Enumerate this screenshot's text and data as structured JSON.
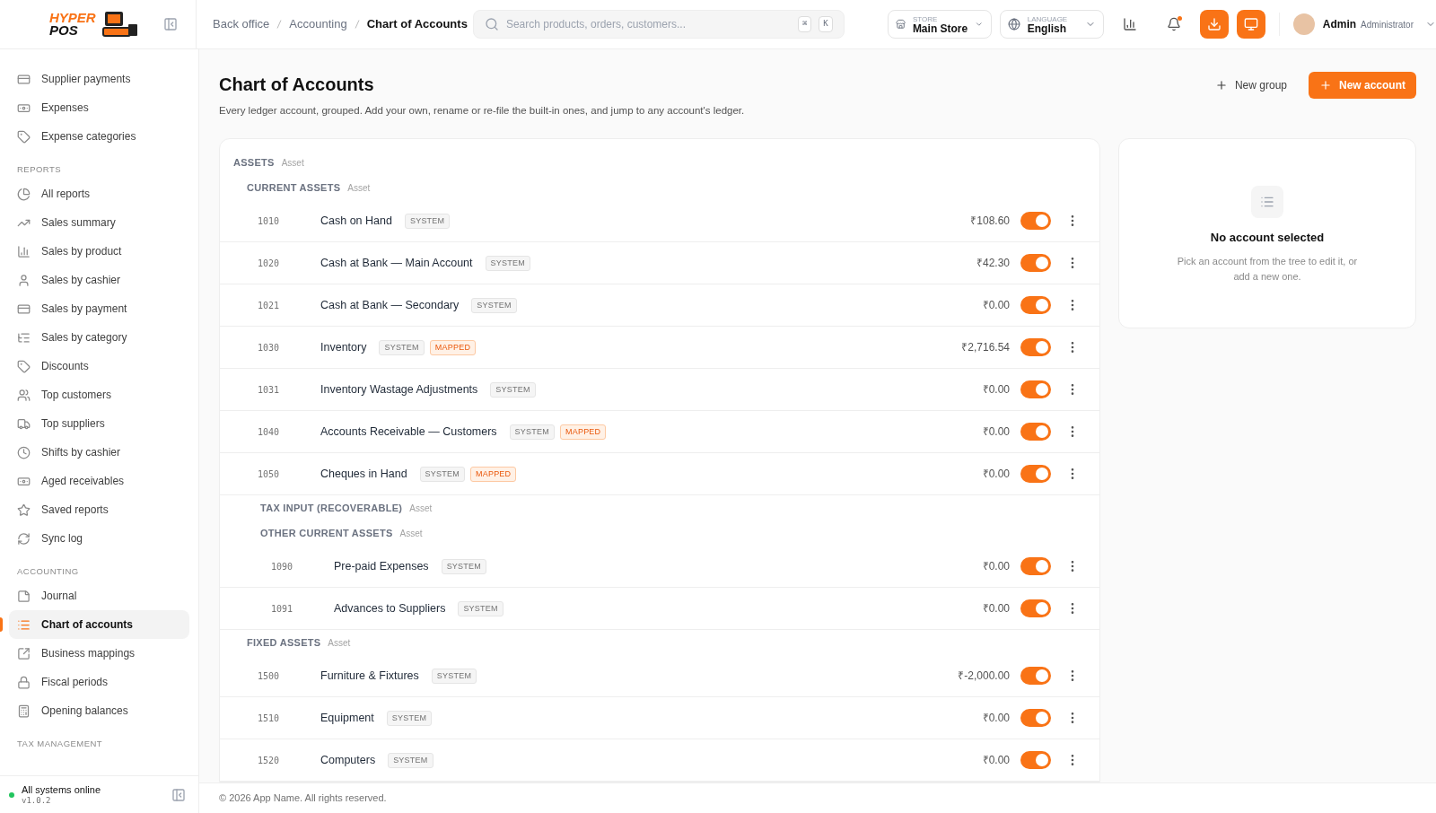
{
  "logo": {
    "line1": "HYPER",
    "line2": "POS"
  },
  "breadcrumb": [
    {
      "label": "Back office",
      "current": false
    },
    {
      "label": "Accounting",
      "current": false
    },
    {
      "label": "Chart of Accounts",
      "current": true
    }
  ],
  "search": {
    "placeholder": "Search products, orders, customers...",
    "keys": [
      "⌘",
      "K"
    ]
  },
  "store": {
    "caption": "STORE",
    "value": "Main Store"
  },
  "language": {
    "caption": "LANGUAGE",
    "value": "English"
  },
  "notifications": {
    "unread": true
  },
  "user": {
    "name": "Admin",
    "role": "Administrator"
  },
  "sidebar": {
    "sections": [
      {
        "items": [
          {
            "label": "Supplier payments",
            "selected": false
          },
          {
            "label": "Expenses",
            "selected": false
          },
          {
            "label": "Expense categories",
            "selected": false
          }
        ]
      },
      {
        "title": "REPORTS",
        "items": [
          {
            "label": "All reports",
            "selected": false
          },
          {
            "label": "Sales summary",
            "selected": false
          },
          {
            "label": "Sales by product",
            "selected": false
          },
          {
            "label": "Sales by cashier",
            "selected": false
          },
          {
            "label": "Sales by payment",
            "selected": false
          },
          {
            "label": "Sales by category",
            "selected": false
          },
          {
            "label": "Discounts",
            "selected": false
          },
          {
            "label": "Top customers",
            "selected": false
          },
          {
            "label": "Top suppliers",
            "selected": false
          },
          {
            "label": "Shifts by cashier",
            "selected": false
          },
          {
            "label": "Aged receivables",
            "selected": false
          },
          {
            "label": "Saved reports",
            "selected": false
          },
          {
            "label": "Sync log",
            "selected": false
          }
        ]
      },
      {
        "title": "ACCOUNTING",
        "items": [
          {
            "label": "Journal",
            "selected": false
          },
          {
            "label": "Chart of accounts",
            "selected": true
          },
          {
            "label": "Business mappings",
            "selected": false
          },
          {
            "label": "Fiscal periods",
            "selected": false
          },
          {
            "label": "Opening balances",
            "selected": false
          }
        ]
      },
      {
        "title": "TAX MANAGEMENT"
      }
    ],
    "status": {
      "label": "All systems online",
      "version": "v1.0.2"
    }
  },
  "page": {
    "title": "Chart of Accounts",
    "subtitle": "Every ledger account, grouped. Add your own, rename or re-file the built-in ones, and jump to any account's ledger.",
    "actions": [
      "New group",
      "New account"
    ]
  },
  "tree": [
    {
      "kind": "group",
      "label": "ASSETS",
      "type": "Asset",
      "children": [
        {
          "kind": "group",
          "label": "CURRENT ASSETS",
          "type": "Asset",
          "children": [
            {
              "kind": "account",
              "code": "1010",
              "name": "Cash on Hand",
              "tags": [
                {
                  "label": "SYSTEM",
                  "kind": "system"
                }
              ],
              "balance": "₹108.60",
              "on": true
            },
            {
              "kind": "account",
              "code": "1020",
              "name": "Cash at Bank — Main Account",
              "tags": [
                {
                  "label": "SYSTEM",
                  "kind": "system"
                }
              ],
              "balance": "₹42.30",
              "on": true
            },
            {
              "kind": "account",
              "code": "1021",
              "name": "Cash at Bank — Secondary",
              "tags": [
                {
                  "label": "SYSTEM",
                  "kind": "system"
                }
              ],
              "balance": "₹0.00",
              "on": true
            },
            {
              "kind": "account",
              "code": "1030",
              "name": "Inventory",
              "tags": [
                {
                  "label": "SYSTEM",
                  "kind": "system"
                },
                {
                  "label": "MAPPED",
                  "kind": "mapped"
                }
              ],
              "balance": "₹2,716.54",
              "on": true
            },
            {
              "kind": "account",
              "code": "1031",
              "name": "Inventory Wastage Adjustments",
              "tags": [
                {
                  "label": "SYSTEM",
                  "kind": "system"
                }
              ],
              "balance": "₹0.00",
              "on": true
            },
            {
              "kind": "account",
              "code": "1040",
              "name": "Accounts Receivable — Customers",
              "tags": [
                {
                  "label": "SYSTEM",
                  "kind": "system"
                },
                {
                  "label": "MAPPED",
                  "kind": "mapped"
                }
              ],
              "balance": "₹0.00",
              "on": true
            },
            {
              "kind": "account",
              "code": "1050",
              "name": "Cheques in Hand",
              "tags": [
                {
                  "label": "SYSTEM",
                  "kind": "system"
                },
                {
                  "label": "MAPPED",
                  "kind": "mapped"
                }
              ],
              "balance": "₹0.00",
              "on": true
            },
            {
              "kind": "group",
              "label": "TAX INPUT (RECOVERABLE)",
              "type": "Asset"
            },
            {
              "kind": "group",
              "label": "OTHER CURRENT ASSETS",
              "type": "Asset",
              "children": [
                {
                  "kind": "account",
                  "code": "1090",
                  "name": "Pre-paid Expenses",
                  "tags": [
                    {
                      "label": "SYSTEM",
                      "kind": "system"
                    }
                  ],
                  "balance": "₹0.00",
                  "on": true
                },
                {
                  "kind": "account",
                  "code": "1091",
                  "name": "Advances to Suppliers",
                  "tags": [
                    {
                      "label": "SYSTEM",
                      "kind": "system"
                    }
                  ],
                  "balance": "₹0.00",
                  "on": true
                }
              ]
            }
          ]
        },
        {
          "kind": "group",
          "label": "FIXED ASSETS",
          "type": "Asset",
          "children": [
            {
              "kind": "account",
              "code": "1500",
              "name": "Furniture & Fixtures",
              "tags": [
                {
                  "label": "SYSTEM",
                  "kind": "system"
                }
              ],
              "balance": "₹-2,000.00",
              "on": true
            },
            {
              "kind": "account",
              "code": "1510",
              "name": "Equipment",
              "tags": [
                {
                  "label": "SYSTEM",
                  "kind": "system"
                }
              ],
              "balance": "₹0.00",
              "on": true
            },
            {
              "kind": "account",
              "code": "1520",
              "name": "Computers",
              "tags": [
                {
                  "label": "SYSTEM",
                  "kind": "system"
                }
              ],
              "balance": "₹0.00",
              "on": true
            }
          ]
        }
      ]
    }
  ],
  "detail": {
    "title": "No account selected",
    "text": "Pick an account from the tree to edit it, or add a new one."
  },
  "footer": "© 2026 App Name. All rights reserved."
}
